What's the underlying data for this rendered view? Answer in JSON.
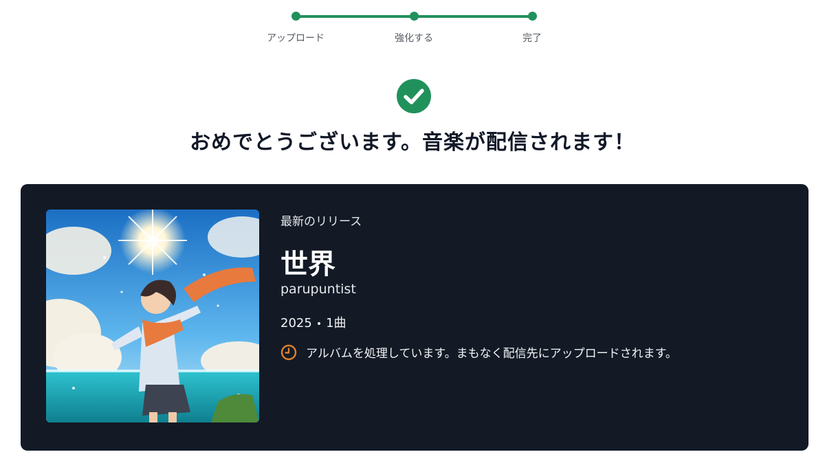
{
  "stepper": {
    "steps": [
      {
        "label": "アップロード"
      },
      {
        "label": "強化する"
      },
      {
        "label": "完了"
      }
    ],
    "accent": "#21915c"
  },
  "success": {
    "icon": "check-circle-icon",
    "headline": "おめでとうございます。音楽が配信されます！"
  },
  "release": {
    "eyebrow": "最新のリリース",
    "title": "世界",
    "artist": "parupuntist",
    "year": "2025",
    "separator": "•",
    "tracks": "1曲",
    "status_icon": "clock-icon",
    "status_text": "アルバムを処理しています。まもなく配信先にアップロードされます。",
    "status_color": "#e0822b",
    "card_bg": "#131a26"
  }
}
